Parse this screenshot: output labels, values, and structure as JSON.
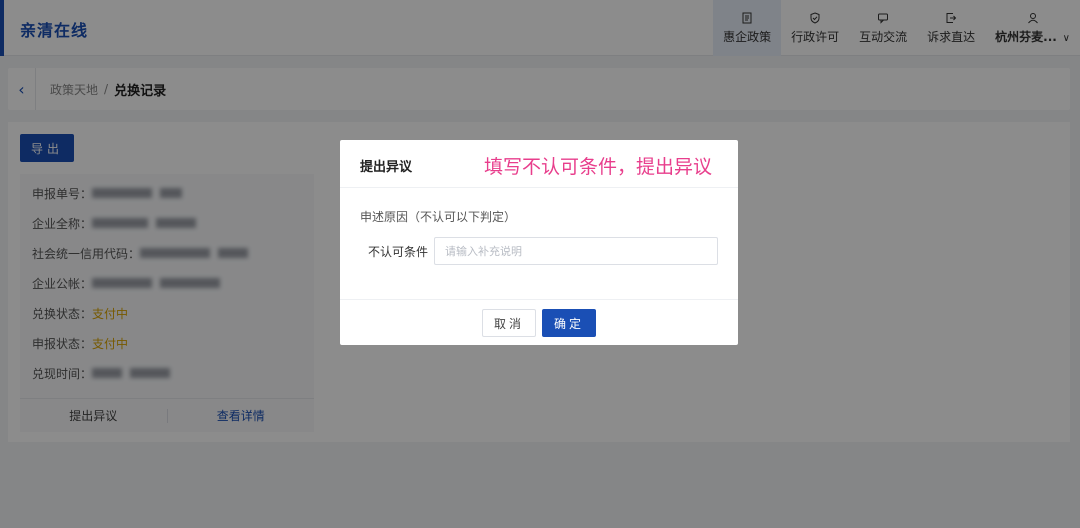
{
  "header": {
    "brand": "亲清在线",
    "nav": [
      {
        "label": "惠企政策",
        "icon": "document-icon",
        "active": true
      },
      {
        "label": "行政许可",
        "icon": "shield-check-icon",
        "active": false
      },
      {
        "label": "互动交流",
        "icon": "chat-icon",
        "active": false
      },
      {
        "label": "诉求直达",
        "icon": "exit-arrow-icon",
        "active": false
      }
    ],
    "user": {
      "label": "杭州芬麦...",
      "icon": "user-icon",
      "caret": "∨"
    }
  },
  "breadcrumb": {
    "back_icon": "chevron-left-icon",
    "back_glyph": "‹",
    "parent": "政策天地",
    "separator": "/",
    "current": "兑换记录"
  },
  "main": {
    "export_label": "导出",
    "card": {
      "rows": [
        {
          "label": "申报单号：",
          "value": ""
        },
        {
          "label": "企业全称：",
          "value": ""
        },
        {
          "label": "社会统一信用代码：",
          "value": ""
        },
        {
          "label": "企业公帐：",
          "value": ""
        },
        {
          "label": "兑换状态：",
          "value": "支付中"
        },
        {
          "label": "申报状态：",
          "value": "支付中"
        },
        {
          "label": "兑现时间：",
          "value": ""
        }
      ],
      "actions": {
        "dispute": "提出异议",
        "detail": "查看详情"
      }
    }
  },
  "modal": {
    "title": "提出异议",
    "annotation": "填写不认可条件，提出异议",
    "section_label": "申述原因（不认可以下判定）",
    "field_label": "不认可条件",
    "field_placeholder": "请输入补充说明",
    "field_value": "",
    "cancel_label": "取消",
    "ok_label": "确定"
  },
  "colors": {
    "primary": "#1a4fb5",
    "annotation": "#e83e8c",
    "status": "#d9a300"
  }
}
